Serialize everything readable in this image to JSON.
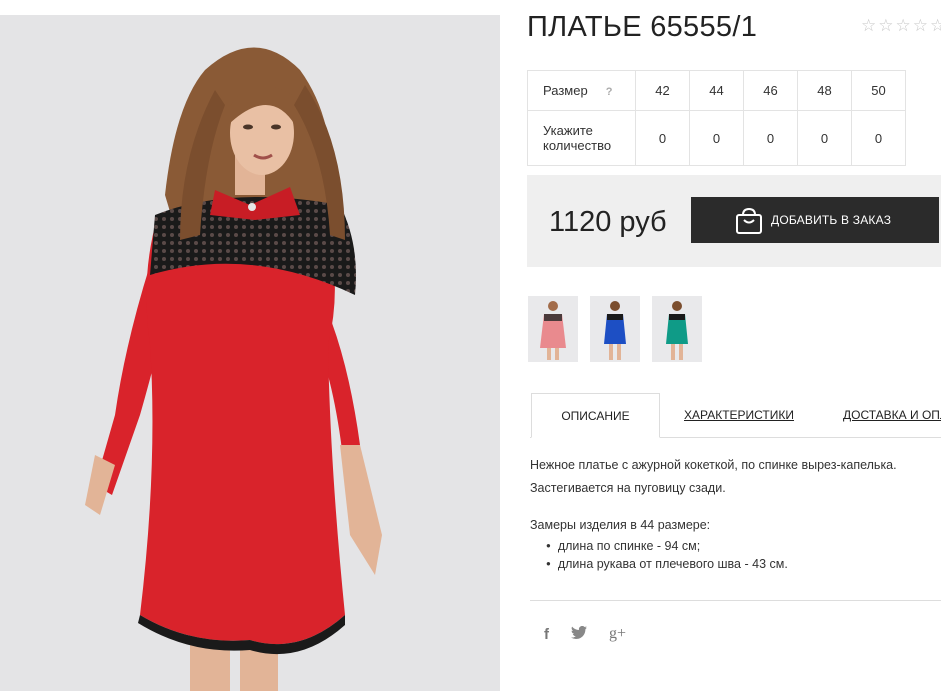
{
  "product": {
    "title": "ПЛАТЬЕ 65555/1",
    "rating_stars": 5,
    "price": "1120 руб"
  },
  "size_table": {
    "size_label": "Размер",
    "help_icon": "?",
    "quantity_label": "Укажите количество",
    "sizes": [
      "42",
      "44",
      "46",
      "48",
      "50"
    ],
    "quantities": [
      "0",
      "0",
      "0",
      "0",
      "0"
    ]
  },
  "cart": {
    "add_label": "ДОБАВИТЬ В ЗАКАЗ",
    "icon": "shopping-bag-icon"
  },
  "thumbnails": [
    {
      "name": "pink-dress",
      "color": "#e98a8e"
    },
    {
      "name": "blue-dress",
      "color": "#1d4fc4"
    },
    {
      "name": "green-dress",
      "color": "#0f9b87"
    }
  ],
  "tabs": [
    {
      "label": "ОПИСАНИЕ",
      "active": true
    },
    {
      "label": "ХАРАКТЕРИСТИКИ",
      "active": false
    },
    {
      "label": "ДОСТАВКА И ОПЛ",
      "active": false
    }
  ],
  "description": {
    "text": "Нежное платье с ажурной кокеткой, по спинке вырез-капелька. Застегивается на пуговицу сзади.",
    "measure_title": "Замеры изделия в 44 размере:",
    "measures": [
      "длина по спинке - 94 см;",
      "длина рукава от плечевого шва - 43 см."
    ]
  },
  "social": [
    {
      "name": "facebook-icon",
      "glyph": "f"
    },
    {
      "name": "twitter-icon",
      "glyph": "🐦"
    },
    {
      "name": "google-plus-icon",
      "glyph": "g+"
    }
  ],
  "colors": {
    "dress_red": "#d9232b",
    "button_dark": "#2b2b2b",
    "price_bg": "#efefef"
  }
}
